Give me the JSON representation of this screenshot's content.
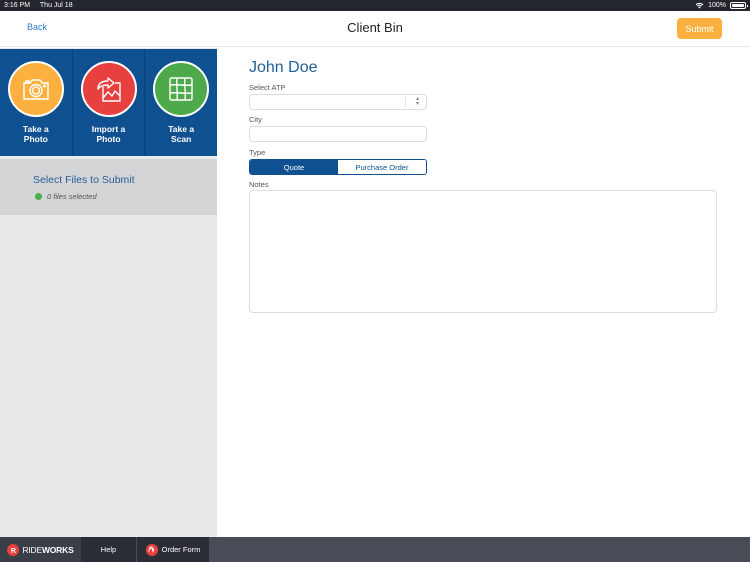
{
  "status_bar": {
    "time": "3:16 PM",
    "date": "Thu Jul 18",
    "battery": "100%",
    "battery_level": 1.0
  },
  "nav": {
    "back_label": "Back",
    "title": "Client Bin",
    "submit_label": "Submit"
  },
  "sidebar": {
    "tiles": [
      {
        "label_line1": "Take a",
        "label_line2": "Photo",
        "icon": "camera-icon",
        "color": "#fbb040"
      },
      {
        "label_line1": "Import a",
        "label_line2": "Photo",
        "icon": "import-photo-icon",
        "color": "#e8403f"
      },
      {
        "label_line1": "Take a",
        "label_line2": "Scan",
        "icon": "scan-grid-icon",
        "color": "#4ea94b"
      }
    ],
    "select_files": {
      "title": "Select Files to Submit",
      "count_text": "0 files selected"
    }
  },
  "form": {
    "client_name": "John Doe",
    "atp_label": "Select ATP",
    "atp_value": "",
    "city_label": "City",
    "city_value": "",
    "type_label": "Type",
    "type_options": [
      "Quote",
      "Purchase Order"
    ],
    "type_selected": "Quote",
    "notes_label": "Notes",
    "notes_value": ""
  },
  "bottom_bar": {
    "logo_light": "RIDE",
    "logo_bold": "WORKS",
    "logo_badge": "R",
    "help_label": "Help",
    "order_form_label": "Order Form"
  },
  "colors": {
    "brand_blue": "#0f5190",
    "accent_orange": "#fbb040",
    "link_blue": "#2e7ccf",
    "status_green": "#4cae4c",
    "brand_red": "#e8403f"
  }
}
